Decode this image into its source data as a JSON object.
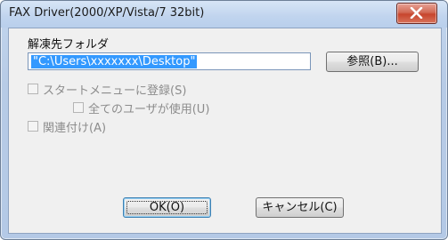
{
  "window": {
    "title": "FAX Driver(2000/XP/Vista/7 32bit)"
  },
  "dialog": {
    "folder_label": "解凍先フォルダ",
    "path_value": "\"C:\\Users\\xxxxxxx\\Desktop\"",
    "browse_label": "参照(B)...",
    "checkbox_start_menu": "スタートメニューに登録(S)",
    "checkbox_all_users": "全てのユーザが使用(U)",
    "checkbox_associate": "関連付け(A)",
    "ok_label": "OK(O)",
    "cancel_label": "キャンセル(C)"
  }
}
